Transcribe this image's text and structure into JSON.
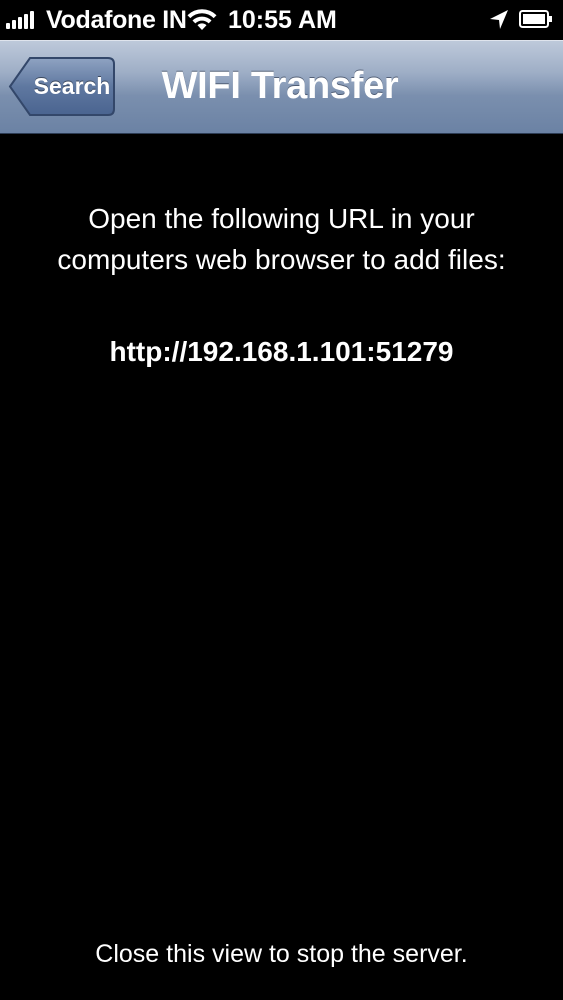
{
  "status_bar": {
    "carrier": "Vodafone IN",
    "time": "10:55 AM",
    "signal_bars": 5
  },
  "nav_bar": {
    "back_label": "Search",
    "title": "WIFI Transfer"
  },
  "content": {
    "instructions": "Open the following URL in your computers web browser to add files:",
    "url": "http://192.168.1.101:51279",
    "footer_note": "Close this view to stop the server."
  },
  "colors": {
    "background": "#000000",
    "nav_bar_top": "#bfcadb",
    "nav_bar_bottom": "#6b82a4",
    "text": "#ffffff"
  },
  "icons": {
    "signal": "signal-bars-icon",
    "wifi": "wifi-icon",
    "location": "location-arrow-icon",
    "battery": "battery-icon"
  }
}
